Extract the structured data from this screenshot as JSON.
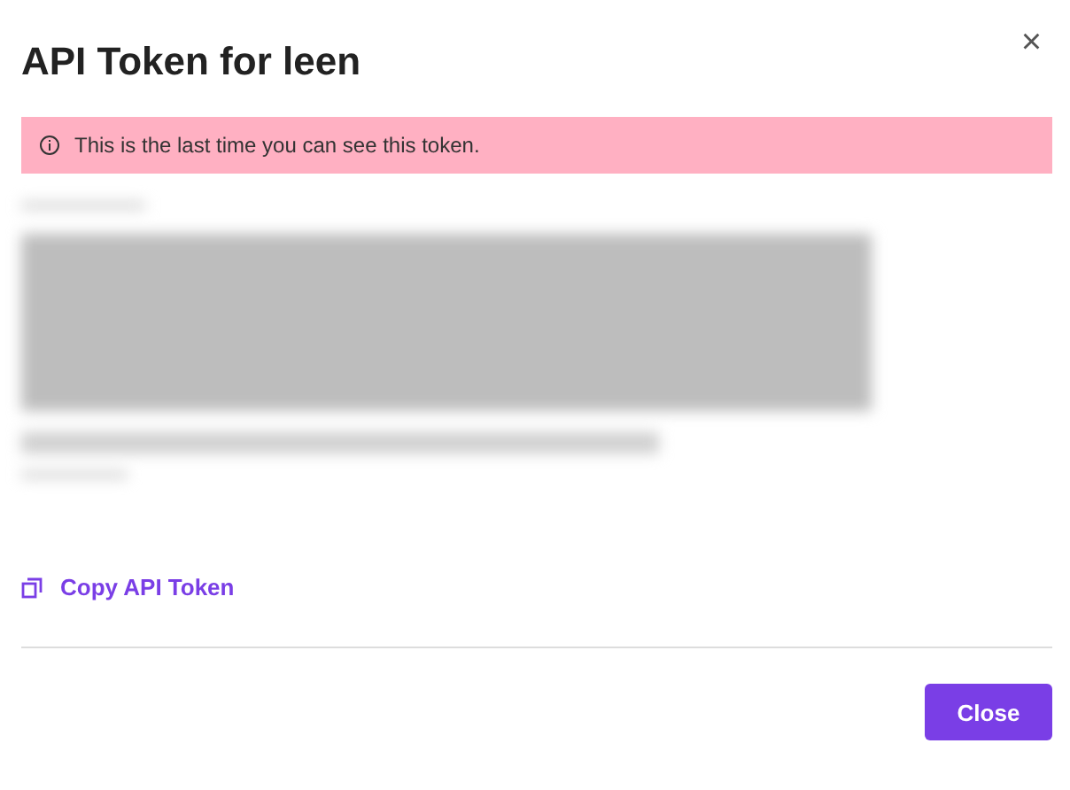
{
  "dialog": {
    "title": "API Token for leen",
    "close_icon": "×"
  },
  "alert": {
    "text": "This is the last time you can see this token."
  },
  "copy_link": {
    "label": "Copy API Token"
  },
  "buttons": [
    {
      "label": "Close"
    }
  ]
}
